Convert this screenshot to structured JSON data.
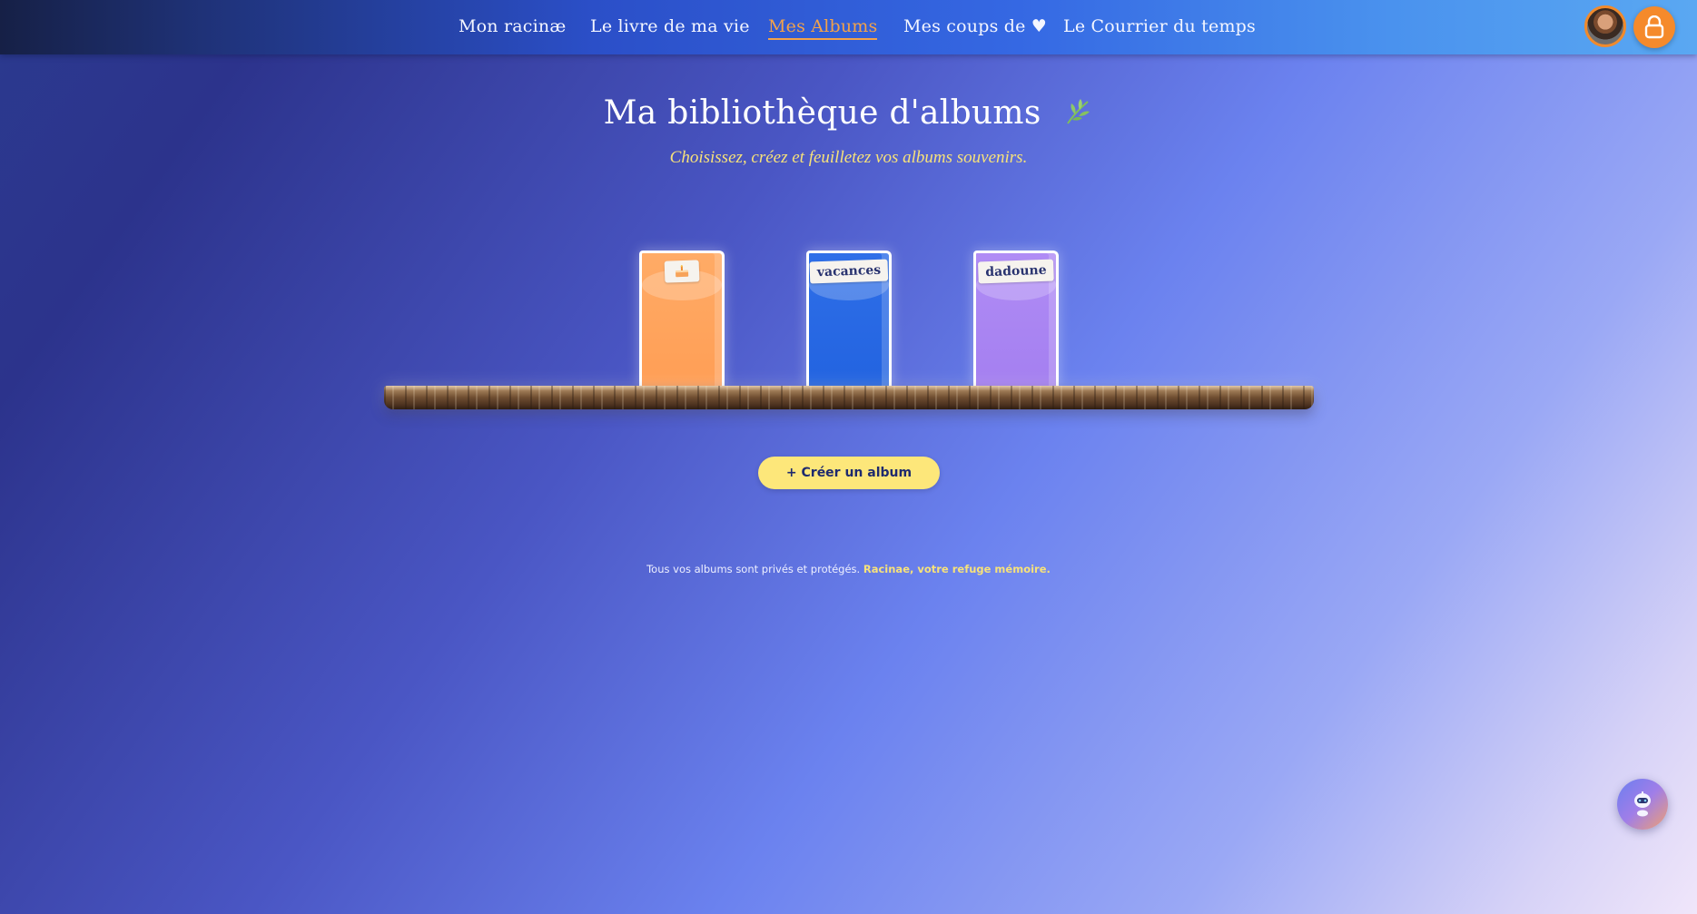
{
  "nav": {
    "items": [
      {
        "label": "Mon racinæ",
        "active": false
      },
      {
        "label": "Le livre de ma vie",
        "active": false
      },
      {
        "label": "Mes Albums",
        "active": true
      },
      {
        "label": "Mes coups de ♥",
        "active": false
      },
      {
        "label": "Le Courrier du temps",
        "active": false
      }
    ],
    "avatar_icon": "user-avatar",
    "lock_icon": "lock-icon"
  },
  "header": {
    "title": "Ma bibliothèque d'albums",
    "title_icon": "leaf-icon",
    "subtitle": "Choisissez, créez et feuilletez vos albums souvenirs."
  },
  "albums": [
    {
      "label": "",
      "icon": "cake-icon",
      "color": "#ffa35c"
    },
    {
      "label": "vacances",
      "color": "#2566e2"
    },
    {
      "label": "dadoune",
      "color": "#a985f2"
    }
  ],
  "actions": {
    "create_label": "+ Créer un album"
  },
  "footer": {
    "note": "Tous vos albums sont privés et protégés.",
    "brand": "Racinae, votre refuge mémoire."
  },
  "assistant": {
    "icon": "robot-icon"
  },
  "colors": {
    "accent": "#f2a24a",
    "button": "#fde77a",
    "subtitle": "#f7e27a"
  }
}
